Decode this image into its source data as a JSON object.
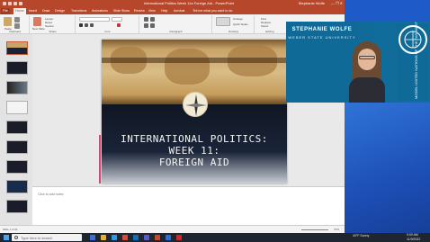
{
  "window": {
    "title": "International Politics Week 11a Foreign Aid  -  PowerPoint",
    "user": "Stephanie Wolfe",
    "controls": "—  ❐  ✕"
  },
  "ribbon": {
    "tabs": [
      "File",
      "Home",
      "Insert",
      "Draw",
      "Design",
      "Transitions",
      "Animations",
      "Slide Show",
      "Review",
      "View",
      "Help",
      "Acrobat",
      "Tell me what you want to do"
    ],
    "active_tab": "Home",
    "groups": [
      "Clipboard",
      "Slides",
      "Font",
      "Paragraph",
      "Drawing",
      "Editing"
    ],
    "items": [
      "Layout",
      "Reset",
      "Section",
      "New Slide",
      "Paste",
      "Arrange",
      "Quick Styles",
      "Find",
      "Replace",
      "Select"
    ]
  },
  "slide": {
    "title_lines": [
      "INTERNATIONAL POLITICS:",
      "WEEK 11:",
      "FOREIGN AID"
    ]
  },
  "notes": {
    "placeholder": "Click to add notes"
  },
  "statusbar": {
    "left": "Slide 1 of 21",
    "zoom": "70%"
  },
  "presenter": {
    "name": "STEPHANIE WOLFE",
    "school": "WEBER STATE UNIVERSITY",
    "seal_text": "MODEL UNITED NATIONS OF THE FAR WEST"
  },
  "taskbar": {
    "search_placeholder": "Type here to search",
    "weather": "40°F  Sunny",
    "time": "9:00 AM",
    "date": "11/9/2022"
  },
  "colors": {
    "ppt_accent": "#b7472a",
    "desktop": "#1e5ac8",
    "cam_blue": "#126e9c"
  }
}
